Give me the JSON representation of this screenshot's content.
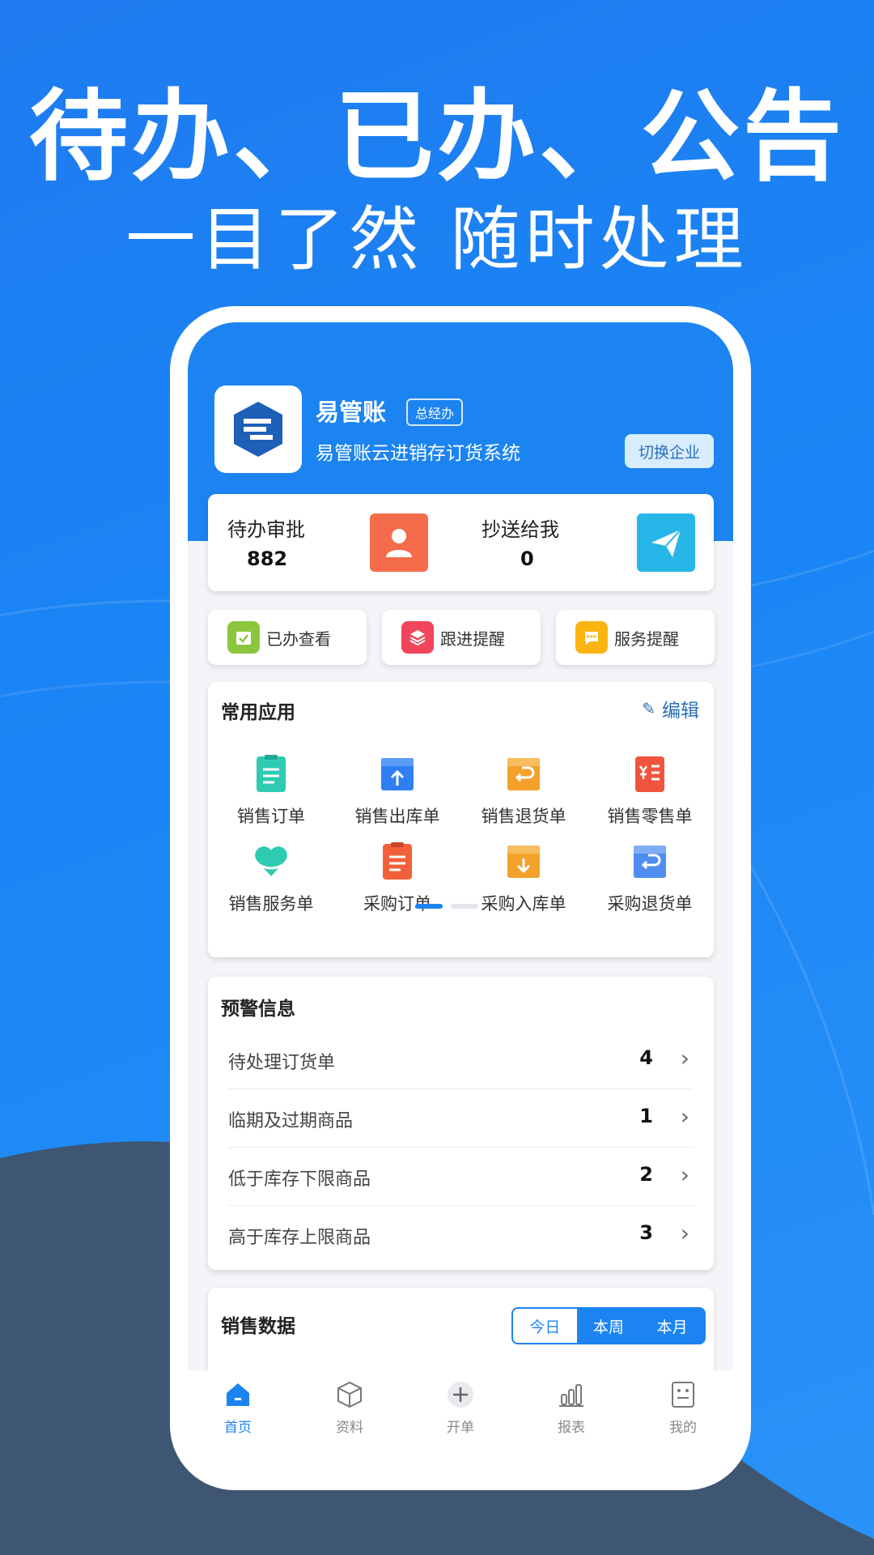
{
  "promo": {
    "headline": "待办、已办、公告",
    "subline": "一目了然  随时处理"
  },
  "header": {
    "app_name": "易管账",
    "role_badge": "总经办",
    "subtitle": "易管账云进销存订货系统",
    "switch_label": "切换企业"
  },
  "approvals": {
    "pending_label": "待办审批",
    "pending_count": "882",
    "cc_label": "抄送给我",
    "cc_count": "0"
  },
  "quick_actions": [
    {
      "label": "已办查看",
      "icon": "calendar-check-icon",
      "color": "#8cc63f"
    },
    {
      "label": "跟进提醒",
      "icon": "layers-icon",
      "color": "#f0455a"
    },
    {
      "label": "服务提醒",
      "icon": "chat-bubble-icon",
      "color": "#fbb40f"
    }
  ],
  "common_apps": {
    "title": "常用应用",
    "edit_label": "编辑",
    "items": [
      {
        "label": "销售订单",
        "icon": "clipboard-icon",
        "color": "#2ecbb1"
      },
      {
        "label": "销售出库单",
        "icon": "box-up-icon",
        "color": "#2f7ff3"
      },
      {
        "label": "销售退货单",
        "icon": "box-return-icon",
        "color": "#f3a12b"
      },
      {
        "label": "销售零售单",
        "icon": "receipt-yen-icon",
        "color": "#f0543c"
      },
      {
        "label": "销售服务单",
        "icon": "heart-hand-icon",
        "color": "#2ecbb1"
      },
      {
        "label": "采购订单",
        "icon": "clipboard-icon",
        "color": "#f2603a"
      },
      {
        "label": "采购入库单",
        "icon": "box-down-icon",
        "color": "#f3a12b"
      },
      {
        "label": "采购退货单",
        "icon": "box-return-icon",
        "color": "#4f8ef0"
      }
    ]
  },
  "warnings": {
    "title": "预警信息",
    "rows": [
      {
        "name": "待处理订货单",
        "count": "4"
      },
      {
        "name": "临期及过期商品",
        "count": "1"
      },
      {
        "name": "低于库存下限商品",
        "count": "2"
      },
      {
        "name": "高于库存上限商品",
        "count": "3"
      }
    ]
  },
  "sales": {
    "title": "销售数据",
    "tabs": [
      "今日",
      "本周",
      "本月"
    ]
  },
  "bottom_nav": [
    {
      "label": "首页",
      "icon": "home-icon"
    },
    {
      "label": "资料",
      "icon": "cube-icon"
    },
    {
      "label": "开单",
      "icon": "plus-circle-icon"
    },
    {
      "label": "报表",
      "icon": "bar-chart-icon"
    },
    {
      "label": "我的",
      "icon": "profile-card-icon"
    }
  ],
  "colors": {
    "accent": "#1c84f1",
    "background_top": "#1f7cf0",
    "background_bottom_dark": "#3e5672"
  }
}
